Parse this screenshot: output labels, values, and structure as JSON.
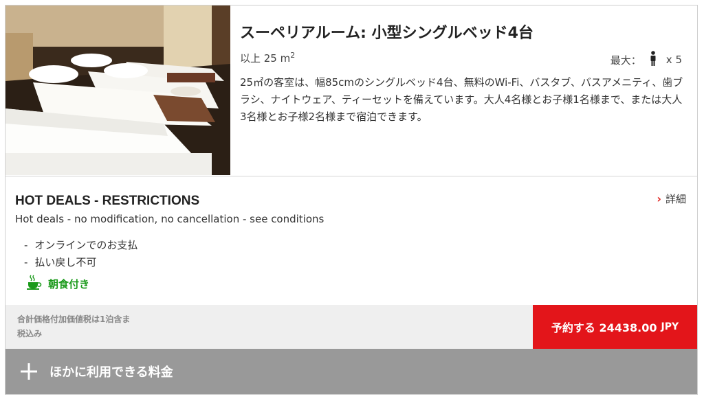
{
  "room": {
    "title": "スーペリアルーム: 小型シングルベッド4台",
    "size_prefix": "以上 25 m",
    "size_sup": "2",
    "max_label": "最大：",
    "max_count": "x 5",
    "description": "25㎡の客室は、幅85cmのシングルベッド4台、無料のWi-Fi、バスタブ、バスアメニティ、歯ブラシ、ナイトウェア、ティーセットを備えています。大人4名様とお子様1名様まで、または大人3名様とお子様2名様まで宿泊できます。"
  },
  "restrictions": {
    "title": "HOT DEALS - RESTRICTIONS",
    "subtitle": "Hot deals - no modification, no cancellation - see conditions",
    "details_label": "詳細",
    "conditions": [
      "オンラインでのお支払",
      "払い戻し不可"
    ],
    "dash": "-",
    "breakfast_label": "朝食付き"
  },
  "price": {
    "tax_note_line1": "合計価格付加価値税は1泊含ま",
    "tax_note_line2": "税込み",
    "book_label": "予約する 24438.00",
    "currency": "JPY"
  },
  "other_rates_label": "ほかに利用できる料金",
  "colors": {
    "accent_red": "#e3151a",
    "breakfast_green": "#1a9a1a",
    "other_rates_bg": "#999999"
  },
  "icons": [
    "person-icon",
    "chevron-right-icon",
    "coffee-cup-icon",
    "plus-icon"
  ]
}
